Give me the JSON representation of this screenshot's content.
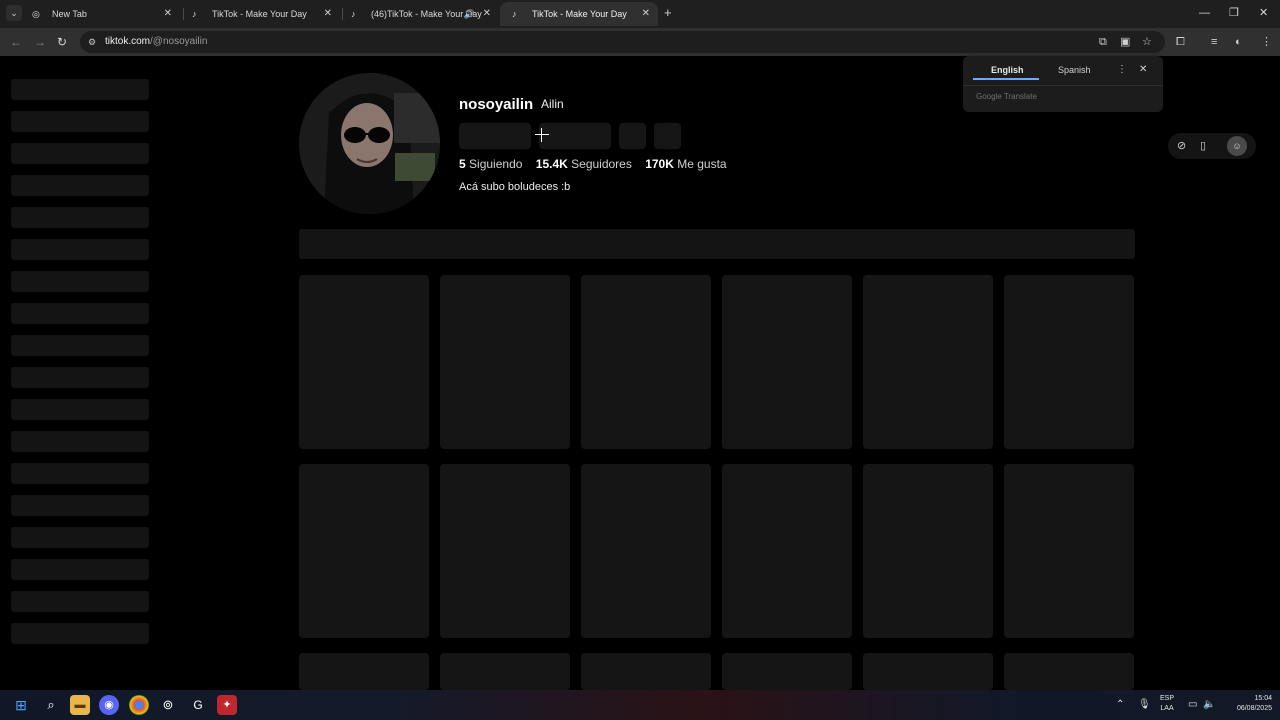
{
  "tabs": [
    {
      "label": "New Tab",
      "icon": "chrome-icon",
      "active": false
    },
    {
      "label": "TikTok - Make Your Day",
      "icon": "tiktok-icon",
      "active": false
    },
    {
      "label": "(46)TikTok - Make Your Day",
      "icon": "tiktok-icon",
      "active": false,
      "audio": true
    },
    {
      "label": "TikTok - Make Your Day",
      "icon": "tiktok-icon",
      "active": true
    }
  ],
  "address": {
    "domain": "tiktok.com",
    "path": "/@nosoyailin"
  },
  "profile": {
    "username": "nosoyailin",
    "nickname": "Ailin",
    "following_count": "5",
    "following_label": "Siguiendo",
    "followers_count": "15.4K",
    "followers_label": "Seguidores",
    "likes_count": "170K",
    "likes_label": "Me gusta",
    "bio": "Acá subo boludeces :b"
  },
  "translate": {
    "lang_source": "English",
    "lang_target": "Spanish",
    "powered_by": "Google Translate"
  },
  "taskbar": {
    "lang_line1": "ESP",
    "lang_line2": "LAA",
    "time": "15:04",
    "date": "06/08/2025"
  },
  "colors": {
    "accent": "#6fa8ff",
    "page_bg": "#000000",
    "skeleton": "#151515"
  }
}
